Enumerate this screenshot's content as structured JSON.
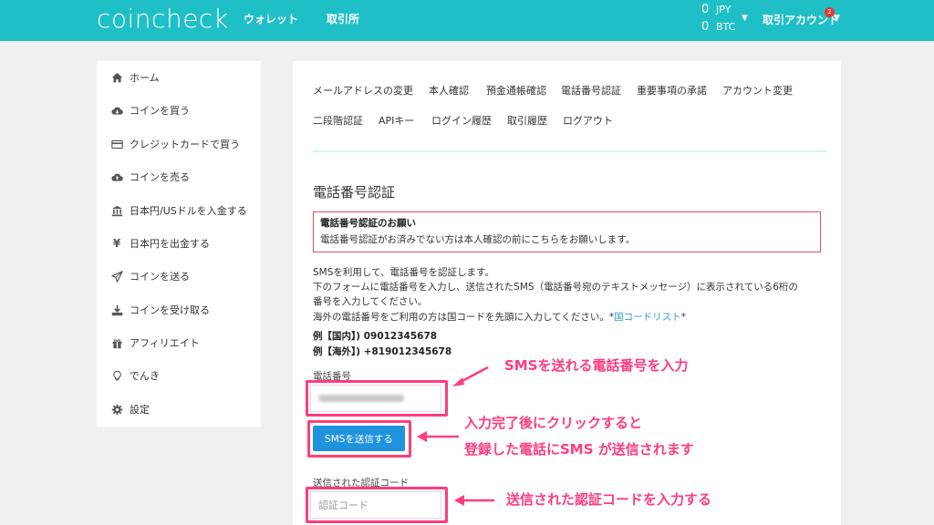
{
  "header": {
    "logo": "coincheck",
    "nav": [
      "ウォレット",
      "取引所"
    ],
    "balances": [
      {
        "amount": "0",
        "currency": "JPY"
      },
      {
        "amount": "0",
        "currency": "BTC"
      }
    ],
    "account_label": "取引アカウント",
    "notification_count": "2"
  },
  "sidebar": {
    "items": [
      {
        "label": "ホーム",
        "icon": "home-icon"
      },
      {
        "label": "コインを買う",
        "icon": "cloud-download-icon"
      },
      {
        "label": "クレジットカードで買う",
        "icon": "credit-card-icon"
      },
      {
        "label": "コインを売る",
        "icon": "cloud-upload-icon"
      },
      {
        "label": "日本円/USドルを入金する",
        "icon": "bank-icon"
      },
      {
        "label": "日本円を出金する",
        "icon": "yen-icon"
      },
      {
        "label": "コインを送る",
        "icon": "send-icon"
      },
      {
        "label": "コインを受け取る",
        "icon": "download-icon"
      },
      {
        "label": "アフィリエイト",
        "icon": "gift-icon"
      },
      {
        "label": "でんき",
        "icon": "lightbulb-icon"
      },
      {
        "label": "設定",
        "icon": "gear-icon"
      }
    ]
  },
  "tabs": {
    "row1": [
      "メールアドレスの変更",
      "本人確認",
      "預金通帳確認",
      "電話番号認証",
      "重要事項の承諾",
      "アカウント変更"
    ],
    "row2": [
      "二段階認証",
      "APIキー",
      "ログイン履歴",
      "取引履歴",
      "ログアウト"
    ]
  },
  "page": {
    "title": "電話番号認証",
    "alert_title": "電話番号認証のお願い",
    "alert_body": "電話番号認証がお済みでない方は本人確認の前にこちらをお願いします。",
    "para1": "SMSを利用して、電話番号を認証します。",
    "para2": "下のフォームに電話番号を入力し、送信されたSMS（電話番号宛のテキストメッセージ）に表示されている6桁の",
    "para3": "番号を入力してください。",
    "para4": "海外の電話番号をご利用の方は国コードを先頭に入力してください。",
    "link_prefix": "*",
    "link_text": "国コードリスト",
    "link_suffix": "*",
    "example_domestic": "例【国内】) 09012345678",
    "example_overseas": "例【海外】) +819012345678",
    "phone_label": "電話番号",
    "send_button": "SMSを送信する",
    "code_label": "送信された認証コード",
    "code_placeholder": "認証コード"
  },
  "annotations": {
    "a1": "SMSを送れる電話番号を入力",
    "a2_line1": "入力完了後にクリックすると",
    "a2_line2": "登録した電話にSMS が送信されます",
    "a3": "送信された認証コードを入力する"
  },
  "colors": {
    "brand": "#1fbfc7",
    "button": "#1f93dd",
    "annotation": "#ff3c7b",
    "alert_border": "#e05454",
    "link": "#2a9fd6"
  }
}
